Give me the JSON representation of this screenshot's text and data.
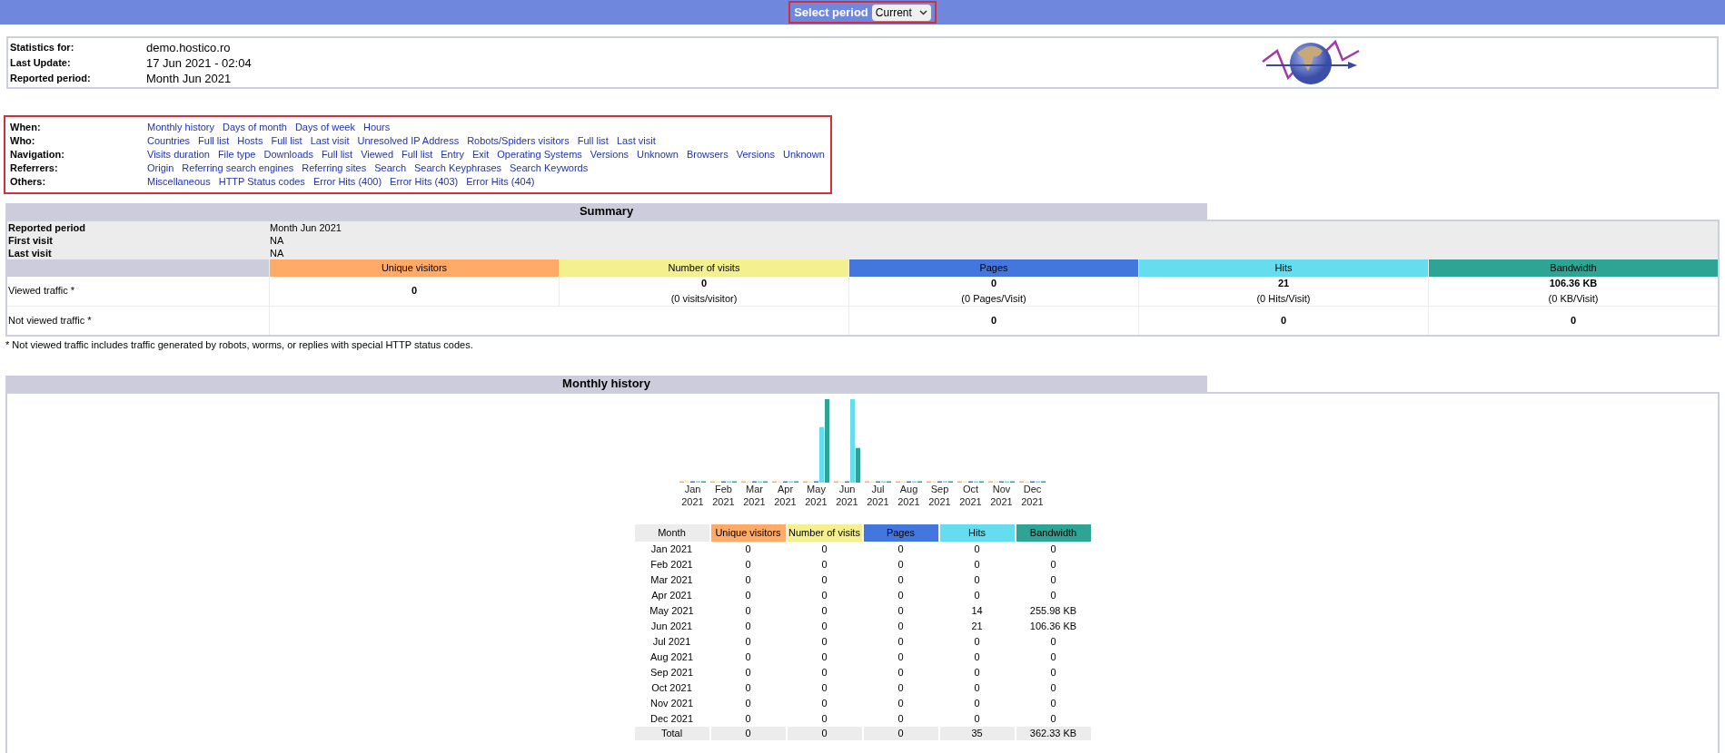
{
  "period_bar": {
    "label": "Select period",
    "value": "Current"
  },
  "stats": [
    {
      "label": "Statistics for:",
      "value": "demo.hostico.ro"
    },
    {
      "label": "Last Update:",
      "value": "17 Jun 2021 - 02:04"
    },
    {
      "label": "Reported period:",
      "value": "Month Jun 2021"
    }
  ],
  "nav": [
    {
      "label": "When:",
      "links": [
        "Monthly history",
        "Days of month",
        "Days of week",
        "Hours"
      ]
    },
    {
      "label": "Who:",
      "links": [
        "Countries",
        "Full list",
        "Hosts",
        "Full list",
        "Last visit",
        "Unresolved IP Address",
        "Robots/Spiders visitors",
        "Full list",
        "Last visit"
      ]
    },
    {
      "label": "Navigation:",
      "links": [
        "Visits duration",
        "File type",
        "Downloads",
        "Full list",
        "Viewed",
        "Full list",
        "Entry",
        "Exit",
        "Operating Systems",
        "Versions",
        "Unknown",
        "Browsers",
        "Versions",
        "Unknown"
      ]
    },
    {
      "label": "Referrers:",
      "links": [
        "Origin",
        "Referring search engines",
        "Referring sites",
        "Search",
        "Search Keyphrases",
        "Search Keywords"
      ]
    },
    {
      "label": "Others:",
      "links": [
        "Miscellaneous",
        "HTTP Status codes",
        "Error Hits (400)",
        "Error Hits (403)",
        "Error Hits (404)"
      ]
    }
  ],
  "summary": {
    "title": "Summary",
    "info": [
      {
        "label": "Reported period",
        "value": "Month Jun 2021"
      },
      {
        "label": "First visit",
        "value": "NA"
      },
      {
        "label": "Last visit",
        "value": "NA"
      }
    ],
    "columns": [
      {
        "label": "Unique visitors",
        "color": "#ffaa66"
      },
      {
        "label": "Number of visits",
        "color": "#f4f090"
      },
      {
        "label": "Pages",
        "color": "#4477dd"
      },
      {
        "label": "Hits",
        "color": "#66ddee"
      },
      {
        "label": "Bandwidth",
        "color": "#2ea495"
      }
    ],
    "viewed": {
      "label": "Viewed traffic *",
      "cells": [
        {
          "value": "0"
        },
        {
          "value": "0",
          "sub": "(0 visits/visitor)"
        },
        {
          "value": "0",
          "sub": "(0 Pages/Visit)"
        },
        {
          "value": "21",
          "sub": "(0 Hits/Visit)"
        },
        {
          "value": "106.36 KB",
          "sub": "(0 KB/Visit)"
        }
      ]
    },
    "not_viewed": {
      "label": "Not viewed traffic *",
      "cells": [
        "0",
        "0",
        "0"
      ]
    },
    "footnote": "* Not viewed traffic includes traffic generated by robots, worms, or replies with special HTTP status codes."
  },
  "monthly": {
    "title": "Monthly history",
    "chart_labels": [
      {
        "month": "Jan",
        "year": "2021"
      },
      {
        "month": "Feb",
        "year": "2021"
      },
      {
        "month": "Mar",
        "year": "2021"
      },
      {
        "month": "Apr",
        "year": "2021"
      },
      {
        "month": "May",
        "year": "2021"
      },
      {
        "month": "Jun",
        "year": "2021"
      },
      {
        "month": "Jul",
        "year": "2021"
      },
      {
        "month": "Aug",
        "year": "2021"
      },
      {
        "month": "Sep",
        "year": "2021"
      },
      {
        "month": "Oct",
        "year": "2021"
      },
      {
        "month": "Nov",
        "year": "2021"
      },
      {
        "month": "Dec",
        "year": "2021"
      }
    ],
    "columns": [
      "Month",
      "Unique visitors",
      "Number of visits",
      "Pages",
      "Hits",
      "Bandwidth"
    ],
    "rows": [
      {
        "label": "Jan 2021",
        "values": [
          "0",
          "0",
          "0",
          "0",
          "0"
        ]
      },
      {
        "label": "Feb 2021",
        "values": [
          "0",
          "0",
          "0",
          "0",
          "0"
        ]
      },
      {
        "label": "Mar 2021",
        "values": [
          "0",
          "0",
          "0",
          "0",
          "0"
        ]
      },
      {
        "label": "Apr 2021",
        "values": [
          "0",
          "0",
          "0",
          "0",
          "0"
        ]
      },
      {
        "label": "May 2021",
        "values": [
          "0",
          "0",
          "0",
          "14",
          "255.98 KB"
        ]
      },
      {
        "label": "Jun 2021",
        "values": [
          "0",
          "0",
          "0",
          "21",
          "106.36 KB"
        ]
      },
      {
        "label": "Jul 2021",
        "values": [
          "0",
          "0",
          "0",
          "0",
          "0"
        ]
      },
      {
        "label": "Aug 2021",
        "values": [
          "0",
          "0",
          "0",
          "0",
          "0"
        ]
      },
      {
        "label": "Sep 2021",
        "values": [
          "0",
          "0",
          "0",
          "0",
          "0"
        ]
      },
      {
        "label": "Oct 2021",
        "values": [
          "0",
          "0",
          "0",
          "0",
          "0"
        ]
      },
      {
        "label": "Nov 2021",
        "values": [
          "0",
          "0",
          "0",
          "0",
          "0"
        ]
      },
      {
        "label": "Dec 2021",
        "values": [
          "0",
          "0",
          "0",
          "0",
          "0"
        ]
      }
    ],
    "total": [
      "Total",
      "0",
      "0",
      "0",
      "35",
      "362.33 KB"
    ]
  }
}
